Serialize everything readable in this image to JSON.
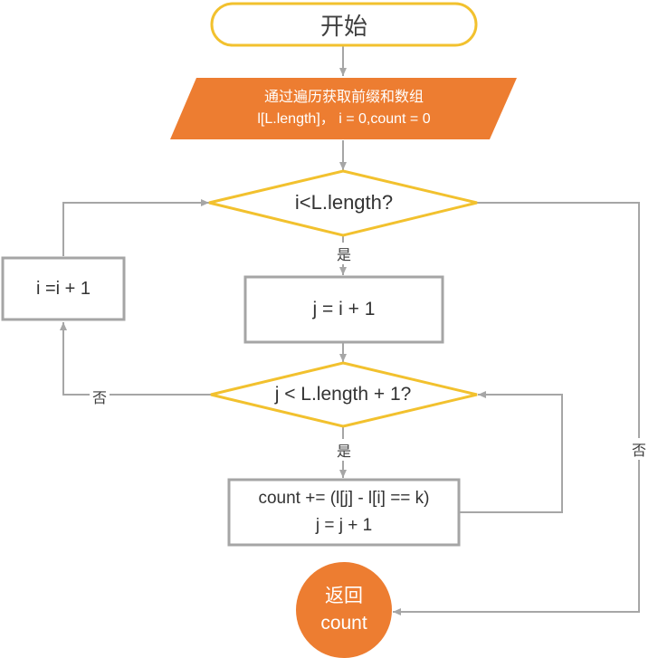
{
  "flowchart": {
    "start": {
      "label": "开始"
    },
    "input": {
      "line1": "通过遍历获取前缀和数组",
      "line2": "l[L.length]，  i = 0,count = 0"
    },
    "cond_outer": {
      "label": "i<L.length?"
    },
    "assign_j": {
      "label": "j = i +  1"
    },
    "increment_i": {
      "label": "i =i + 1"
    },
    "cond_inner": {
      "label": "j < L.length + 1?"
    },
    "update": {
      "line1": "count += (l[j] - l[i] == k)",
      "line2": "j = j + 1"
    },
    "end": {
      "line1": "返回",
      "line2": "count"
    },
    "edge_labels": {
      "outer_yes": "是",
      "inner_yes": "是",
      "inner_no": "否",
      "outer_no": "否"
    },
    "colors": {
      "start_border": "#F2C12E",
      "orange": "#ED7D31",
      "diamond_border": "#F2C12E",
      "box_border": "#A5A5A5",
      "arrow": "#A6A6A6"
    }
  }
}
